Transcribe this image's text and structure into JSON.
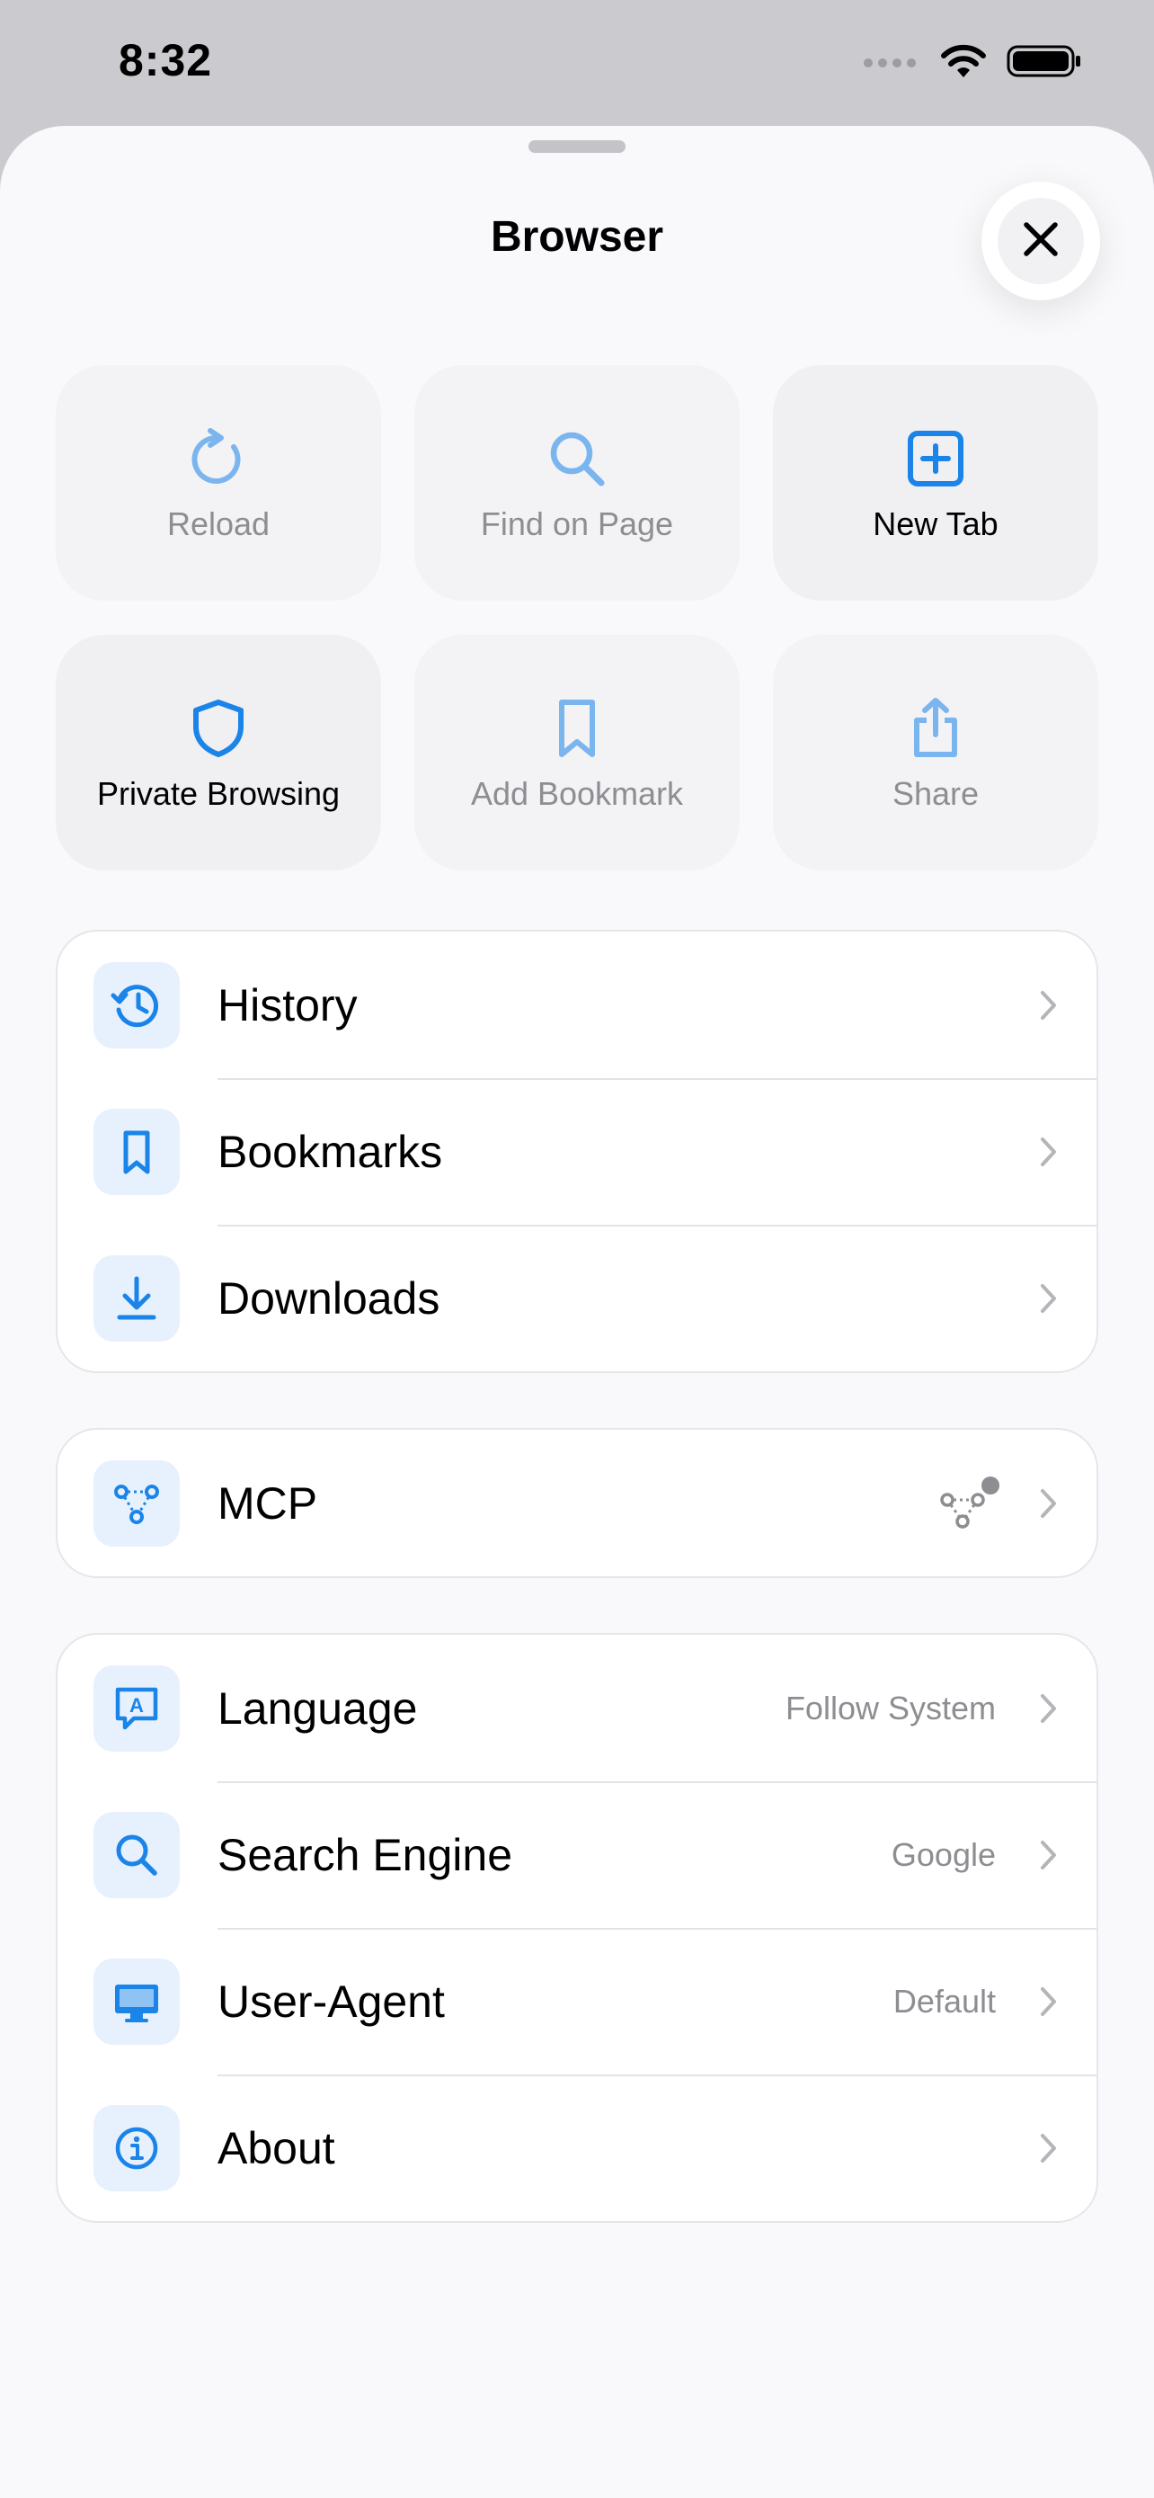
{
  "status": {
    "time": "8:32"
  },
  "sheet": {
    "title": "Browser"
  },
  "quick_actions": [
    {
      "label": "Reload",
      "icon": "reload-icon",
      "enabled": false
    },
    {
      "label": "Find on Page",
      "icon": "search-icon",
      "enabled": false
    },
    {
      "label": "New Tab",
      "icon": "plus-square-icon",
      "enabled": true
    },
    {
      "label": "Private Browsing",
      "icon": "shield-icon",
      "enabled": true
    },
    {
      "label": "Add Bookmark",
      "icon": "bookmark-icon",
      "enabled": false
    },
    {
      "label": "Share",
      "icon": "share-icon",
      "enabled": false
    }
  ],
  "groups": {
    "library": [
      {
        "label": "History",
        "icon": "history-icon"
      },
      {
        "label": "Bookmarks",
        "icon": "bookmark-icon"
      },
      {
        "label": "Downloads",
        "icon": "download-icon"
      }
    ],
    "mcp": [
      {
        "label": "MCP",
        "icon": "mcp-icon",
        "status_icon": "mcp-status-icon"
      }
    ],
    "settings": [
      {
        "label": "Language",
        "icon": "language-icon",
        "value": "Follow System"
      },
      {
        "label": "Search Engine",
        "icon": "search-icon",
        "value": "Google"
      },
      {
        "label": "User-Agent",
        "icon": "desktop-icon",
        "value": "Default"
      },
      {
        "label": "About",
        "icon": "info-icon"
      }
    ]
  },
  "colors": {
    "accent": "#1a84e8",
    "accent_disabled": "#7bb8ee",
    "icon_bg": "#e7f1fd",
    "secondary_text": "#8d8d92"
  }
}
